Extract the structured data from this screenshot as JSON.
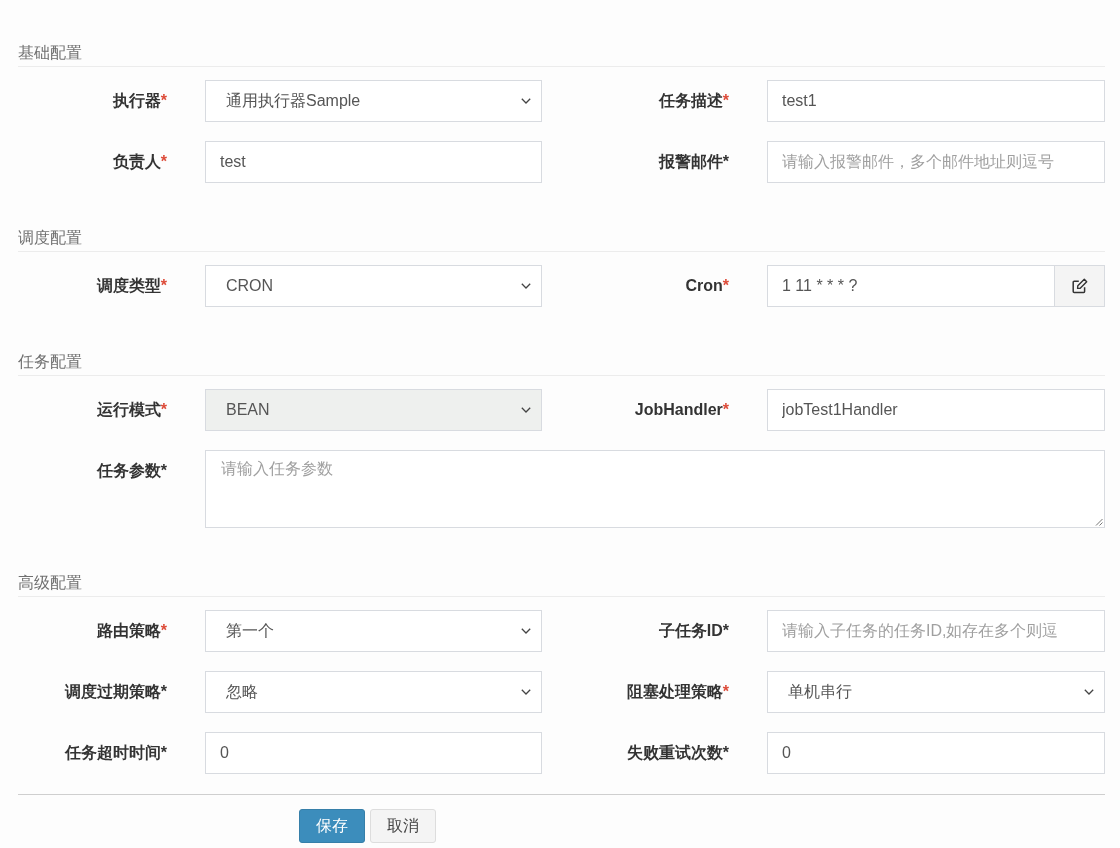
{
  "sections": [
    {
      "title": "基础配置",
      "fields": [
        {
          "label": "执行器",
          "asterisk": "*",
          "color": "#dd4b39",
          "kind": "select",
          "value": "通用执行器Sample",
          "disabled": false
        },
        {
          "label": "任务描述",
          "asterisk": "*",
          "color": "#dd4b39",
          "kind": "input",
          "value": "test1",
          "disabled": false
        },
        {
          "label": "负责人",
          "asterisk": "*",
          "color": "#dd4b39",
          "kind": "input",
          "value": "test",
          "disabled": false
        },
        {
          "label": "报警邮件",
          "asterisk": "*",
          "color": "#333333",
          "kind": "input",
          "placeholder": "请输入报警邮件，多个邮件地址则逗号",
          "disabled": false
        }
      ]
    },
    {
      "title": "调度配置",
      "fields": [
        {
          "label": "调度类型",
          "asterisk": "*",
          "color": "#dd4b39",
          "kind": "select",
          "value": "CRON",
          "disabled": false
        },
        {
          "label": "Cron",
          "asterisk": "*",
          "color": "#dd4b39",
          "kind": "input_button",
          "value": "1 11 * * * ?",
          "disabled": false
        }
      ]
    },
    {
      "title": "任务配置",
      "fields": [
        {
          "label": "运行模式",
          "asterisk": "*",
          "color": "#dd4b39",
          "kind": "select",
          "value": "BEAN",
          "disabled": true
        },
        {
          "label": "JobHandler",
          "asterisk": "*",
          "color": "#dd4b39",
          "kind": "input",
          "value": "jobTest1Handler",
          "disabled": false
        },
        {
          "label": "任务参数",
          "asterisk": "*",
          "color": "#333333",
          "kind": "textarea",
          "placeholder": "请输入任务参数",
          "disabled": false
        }
      ]
    },
    {
      "title": "高级配置",
      "fields": [
        {
          "label": "路由策略",
          "asterisk": "*",
          "color": "#dd4b39",
          "kind": "select",
          "value": "第一个",
          "disabled": false
        },
        {
          "label": "子任务ID",
          "asterisk": "*",
          "color": "#333333",
          "kind": "input",
          "placeholder": "请输入子任务的任务ID,如存在多个则逗",
          "disabled": false
        },
        {
          "label": "调度过期策略",
          "asterisk": "*",
          "color": "#333333",
          "kind": "select",
          "value": "忽略",
          "disabled": false
        },
        {
          "label": "阻塞处理策略",
          "asterisk": "*",
          "color": "#dd4b39",
          "kind": "select",
          "value": "单机串行",
          "disabled": false
        },
        {
          "label": "任务超时时间",
          "asterisk": "*",
          "color": "#333333",
          "kind": "input",
          "value": "0",
          "disabled": false
        },
        {
          "label": "失败重试次数",
          "asterisk": "*",
          "color": "#333333",
          "kind": "input",
          "value": "0",
          "disabled": false
        }
      ]
    }
  ],
  "buttons": [
    {
      "label": "保存",
      "kind": "primary"
    },
    {
      "label": "取消",
      "kind": "default"
    }
  ]
}
